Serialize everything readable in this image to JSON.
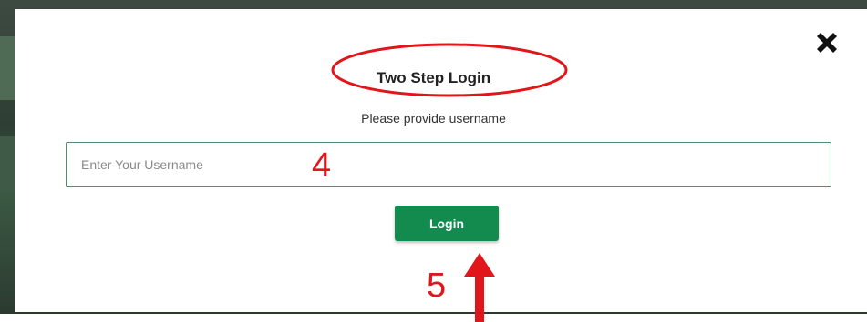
{
  "modal": {
    "title": "Two Step Login",
    "subtitle": "Please provide username",
    "username_placeholder": "Enter Your Username",
    "username_value": "",
    "login_label": "Login",
    "close_icon": "close-x-icon"
  },
  "annotations": {
    "step_input": "4",
    "step_button": "5",
    "color": "#e0161b"
  },
  "colors": {
    "accent_green": "#138a4e",
    "input_border": "#4e8f6d",
    "backdrop": "#2f3e34"
  }
}
